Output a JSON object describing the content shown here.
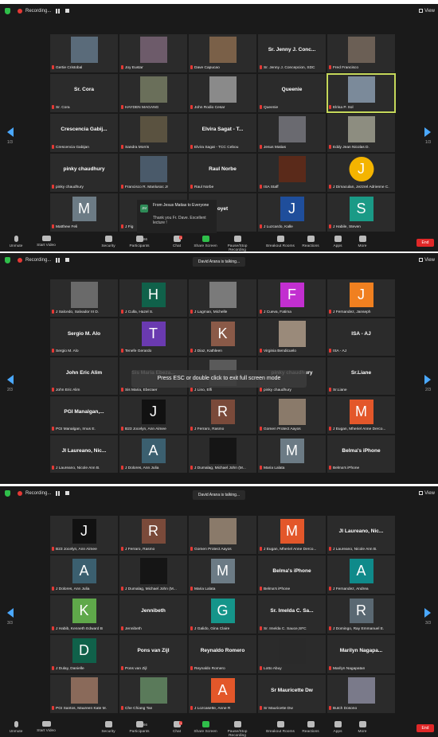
{
  "screens": [
    {
      "recording_label": "Recording...",
      "view_label": "View",
      "page_left": "1/3",
      "page_right": "1/3",
      "chat_popup": {
        "initials": "JM",
        "from": "From Jesus Matias to Everyone",
        "message": "Thank you Fr. Dave. Excellent lecture !"
      },
      "tiles": [
        {
          "kind": "photo",
          "name": "Gertie Cristobal",
          "bg": "#5a6b7a"
        },
        {
          "kind": "photo",
          "name": "Joy Eustar",
          "bg": "#6d5b6a"
        },
        {
          "kind": "photo",
          "name": "Dave Capucao",
          "bg": "#7a6048"
        },
        {
          "kind": "text",
          "title": "Sr. Jenny J. Conc...",
          "name": "Sr. Jenny J. Concepcion, SDC"
        },
        {
          "kind": "photo",
          "name": "Fred Francisco",
          "bg": "#6b5f55"
        },
        {
          "kind": "text",
          "title": "Sr. Cora",
          "name": "Sr. Cora"
        },
        {
          "kind": "photo",
          "name": "HAYDEN MAGANG",
          "bg": "#6a6f5a"
        },
        {
          "kind": "photo",
          "name": "John Rodio Cesar",
          "bg": "#8a8a8a"
        },
        {
          "kind": "text",
          "title": "Queenie",
          "name": "Queenie"
        },
        {
          "kind": "photo",
          "name": "Elrisa P. Sol",
          "bg": "#7b8a9a",
          "highlight": true
        },
        {
          "kind": "text",
          "title": "Crescencia Gabij...",
          "name": "Crescencia Gabijan"
        },
        {
          "kind": "photo",
          "name": "Sandra Morris",
          "bg": "#5a5240"
        },
        {
          "kind": "text",
          "title": "Elvira Sagat - T...",
          "name": "Elvira Sagat - TCC Cebou"
        },
        {
          "kind": "photo",
          "name": "Jesus Matias",
          "bg": "#6a6a70"
        },
        {
          "kind": "photo",
          "name": "Eddy Jean Nicolas D.",
          "bg": "#8d8d80"
        },
        {
          "kind": "text",
          "title": "pinky chaudhury",
          "name": "pinky chaudhury"
        },
        {
          "kind": "photo",
          "name": "Francisco R. Manlusoc Jr",
          "bg": "#4a5a6a"
        },
        {
          "kind": "text",
          "title": "Raul Norbe",
          "name": "Raul Norbe"
        },
        {
          "kind": "photo",
          "name": "ISA Staff",
          "bg": "#5a2a1a"
        },
        {
          "kind": "avatar",
          "letter": "J",
          "color": "#f4b400",
          "circle": true,
          "name": "J Dimaculan, Jezzrel Adrienne C."
        },
        {
          "kind": "avatar",
          "letter": "M",
          "color": "#6c7b85",
          "name": "Matthew Feli"
        },
        {
          "kind": "text",
          "title": "",
          "name": "J Fig"
        },
        {
          "kind": "text",
          "title": "oyet",
          "name": ""
        },
        {
          "kind": "avatar",
          "letter": "J",
          "color": "#1f4e9b",
          "name": "J Luzcardo, Kalle"
        },
        {
          "kind": "avatar",
          "letter": "S",
          "color": "#1a9a86",
          "name": "J Habile, Steven"
        }
      ]
    },
    {
      "recording_label": "Recording...",
      "view_label": "View",
      "talking_label": "David Arana is talking...",
      "esc_message": "Press ESC or double click to exit full screen mode",
      "page_left": "2/3",
      "page_right": "2/3",
      "tiles": [
        {
          "kind": "photo",
          "name": "J Salcedo, Salvador III D.",
          "bg": "#6a6a6a"
        },
        {
          "kind": "avatar",
          "letter": "H",
          "color": "#10614a",
          "name": "J Culla, Hazel S."
        },
        {
          "kind": "photo",
          "name": "J Lagman, Michelle",
          "bg": "#7a7a7a"
        },
        {
          "kind": "avatar",
          "letter": "F",
          "color": "#c22fd0",
          "name": "J Cueva, Fatima"
        },
        {
          "kind": "avatar",
          "letter": "J",
          "color": "#f08020",
          "name": "J Fernandez, Janseph"
        },
        {
          "kind": "text",
          "title": "Sergio M. Alo",
          "name": "Sergio M. Alo"
        },
        {
          "kind": "avatar",
          "letter": "T",
          "color": "#6a3ab0",
          "name": "Tenefe Gerardo"
        },
        {
          "kind": "avatar",
          "letter": "K",
          "color": "#8a5a48",
          "name": "J Diaz, Kathleen"
        },
        {
          "kind": "photo",
          "name": "Virginia Bendicuelo",
          "bg": "#9a8a7a"
        },
        {
          "kind": "text",
          "title": "ISA - AJ",
          "name": "ISA - AJ"
        },
        {
          "kind": "text",
          "title": "John Eric Alim",
          "name": "John Eric Alim"
        },
        {
          "kind": "text",
          "title": "Sis Maria Ebeza...",
          "name": "Sis Maria, Ebezaer"
        },
        {
          "kind": "photo",
          "name": "J Lino, Elfi",
          "bg": "#5a5a5a"
        },
        {
          "kind": "text",
          "title": "pinky chaudhury",
          "name": "pinky chaudhury"
        },
        {
          "kind": "text",
          "title": "Sr.Liane",
          "name": "Sr.Liane"
        },
        {
          "kind": "text",
          "title": "PGI Manalgan,...",
          "name": "PGI Manalgan, Irnus E."
        },
        {
          "kind": "avatar",
          "letter": "J",
          "color": "#111111",
          "name": "B23 Jocelyn, Ann Aimee"
        },
        {
          "kind": "avatar",
          "letter": "R",
          "color": "#7a4a3a",
          "name": "J Ferraro, Rasmo"
        },
        {
          "kind": "photo",
          "name": "Gomen Protect Aayos",
          "bg": "#8a7a6a"
        },
        {
          "kind": "avatar",
          "letter": "M",
          "color": "#e3572a",
          "name": "J Eugan, Mheriel Anne Derco..."
        },
        {
          "kind": "text",
          "title": "JI Laureano, Nic...",
          "name": "J Laureano, Nicole Ann B."
        },
        {
          "kind": "avatar",
          "letter": "A",
          "color": "#3b5f6f",
          "name": "J Dolores, Ann Julia"
        },
        {
          "kind": "photo",
          "name": "J Dumalag, Michael John (M...",
          "bg": "#151515"
        },
        {
          "kind": "avatar",
          "letter": "M",
          "color": "#6c7b85",
          "name": "Maria Lalata"
        },
        {
          "kind": "text",
          "title": "Belma's iPhone",
          "name": "Belma's iPhone"
        }
      ]
    },
    {
      "recording_label": "Recording...",
      "view_label": "View",
      "talking_label": "David Arana is talking...",
      "page_left": "3/3",
      "page_right": "3/3",
      "tiles": [
        {
          "kind": "avatar",
          "letter": "J",
          "color": "#111111",
          "name": "B23 Jocelyn, Ann Aimee"
        },
        {
          "kind": "avatar",
          "letter": "R",
          "color": "#7a4a3a",
          "name": "J Ferraro, Rasmo"
        },
        {
          "kind": "photo",
          "name": "Gomen Protect Aayos",
          "bg": "#8a7a6a"
        },
        {
          "kind": "avatar",
          "letter": "M",
          "color": "#e3572a",
          "name": "J Eugan, Mheriel Anne Derco..."
        },
        {
          "kind": "text",
          "title": "JI Laureano, Nic...",
          "name": "J Laureano, Nicole Ann B."
        },
        {
          "kind": "avatar",
          "letter": "A",
          "color": "#3b5f6f",
          "name": "J Dolores, Ann Julia"
        },
        {
          "kind": "photo",
          "name": "J Dumalag, Michael John (M...",
          "bg": "#151515"
        },
        {
          "kind": "avatar",
          "letter": "M",
          "color": "#6c7b85",
          "name": "Maria Lalata"
        },
        {
          "kind": "text",
          "title": "Belma's iPhone",
          "name": "Belma's iPhone"
        },
        {
          "kind": "avatar",
          "letter": "A",
          "color": "#0f8a8a",
          "name": "J Fernandez, Andrea"
        },
        {
          "kind": "avatar",
          "letter": "K",
          "color": "#5fa84a",
          "name": "J Habib, Kenneth Edward B"
        },
        {
          "kind": "text",
          "title": "Jennibeth",
          "name": "Jennibeth"
        },
        {
          "kind": "avatar",
          "letter": "G",
          "color": "#15958a",
          "name": "J Galido, Gina Claire"
        },
        {
          "kind": "text",
          "title": "Sr. Imelda C. Sa...",
          "name": "Sr. Imelda C. Sauce,SFC"
        },
        {
          "kind": "avatar",
          "letter": "R",
          "color": "#5a6872",
          "name": "J Domingo, Ray Emmanuel E."
        },
        {
          "kind": "avatar",
          "letter": "D",
          "color": "#10614a",
          "name": "J Dulay, Danielle"
        },
        {
          "kind": "text",
          "title": "Pons van Zijl",
          "name": "Pons van Zijl"
        },
        {
          "kind": "text",
          "title": "Reynaldo Romero",
          "name": "Reynaldo Romero"
        },
        {
          "kind": "photo",
          "name": "Lotto Abuy",
          "bg": "#2a2a2a"
        },
        {
          "kind": "text",
          "title": "Marilyn Nagapa...",
          "name": "Marilyn Nagapatan"
        },
        {
          "kind": "photo",
          "name": "PGI Santos, Maureen Kate M.",
          "bg": "#8a6a5a"
        },
        {
          "kind": "photo",
          "name": "Che Chiang Tan",
          "bg": "#5a7a5a"
        },
        {
          "kind": "avatar",
          "letter": "A",
          "color": "#e3572a",
          "name": "J Lozcasette, Anne R"
        },
        {
          "kind": "text",
          "title": "Sr Mauricette Dw",
          "name": "Sr Mauricette Dw"
        },
        {
          "kind": "photo",
          "name": "Butch Dosono",
          "bg": "#7a7a8a"
        }
      ]
    }
  ],
  "toolbar": {
    "unmute": "Unmute",
    "start_video": "Start Video",
    "security": "Security",
    "participants": "Participants",
    "participants_count": "66",
    "chat": "Chat",
    "chat_badge": "1",
    "share_screen": "Share Screen",
    "pause_recording": "Pause/Stop Recording",
    "breakout_rooms": "Breakout Rooms",
    "reactions": "Reactions",
    "apps": "Apps",
    "more": "More",
    "end": "End"
  }
}
